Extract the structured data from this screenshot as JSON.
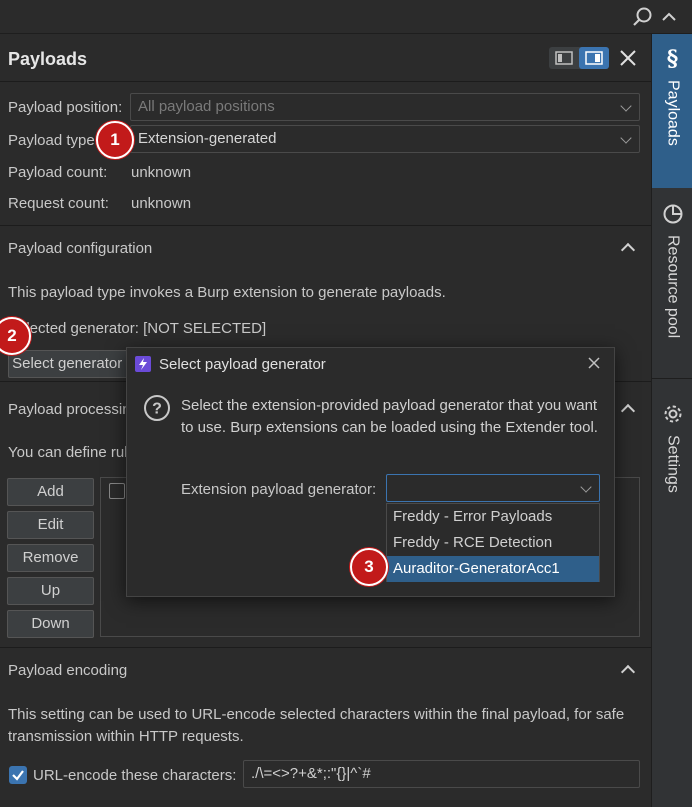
{
  "colors": {
    "accent": "#2f5f8a",
    "badge": "#c21a1a",
    "background": "#2b2b2b"
  },
  "panel": {
    "title": "Payloads",
    "position_label": "Payload position:",
    "position_placeholder": "All payload positions",
    "type_label": "Payload type:",
    "type_value": "Extension-generated",
    "count_label": "Payload count:",
    "count_value": "unknown",
    "request_label": "Request count:",
    "request_value": "unknown"
  },
  "config": {
    "title": "Payload configuration",
    "description": "This payload type invokes a Burp extension to generate payloads.",
    "selected_label": "Selected generator: [NOT SELECTED]",
    "select_button": "Select generator ..."
  },
  "processing": {
    "title": "Payload processing",
    "description": "You can define rules to perform various processing tasks on each payload before it is used.",
    "buttons": [
      "Add",
      "Edit",
      "Remove",
      "Up",
      "Down"
    ]
  },
  "encoding": {
    "title": "Payload encoding",
    "description": "This setting can be used to URL-encode selected characters within the final payload, for safe transmission within HTTP requests.",
    "checkbox_label": "URL-encode these characters:",
    "checkbox_checked": true,
    "chars": "./\\=<>?+&*;:\"{}|^`#"
  },
  "dialog": {
    "title": "Select payload generator",
    "message": "Select the extension-provided payload generator that you want to use. Burp extensions can be loaded using the Extender tool.",
    "generator_label": "Extension payload generator:",
    "generator_value": "",
    "options": [
      "Freddy - Error Payloads",
      "Freddy - RCE Detection",
      "Auraditor-GeneratorAcc1"
    ],
    "selected_index": 2
  },
  "badges": [
    "1",
    "2",
    "3"
  ],
  "rail": {
    "tabs": [
      {
        "label": "Payloads",
        "icon": "dollar-icon",
        "active": true
      },
      {
        "label": "Resource pool",
        "icon": "pie-chart-icon",
        "active": false
      },
      {
        "label": "Settings",
        "icon": "gear-icon",
        "active": false
      }
    ]
  },
  "icons": [
    "search-icon",
    "chevron-up-icon",
    "layout-left-icon",
    "layout-right-icon",
    "close-icon",
    "burp-icon",
    "question-icon",
    "check-icon"
  ]
}
